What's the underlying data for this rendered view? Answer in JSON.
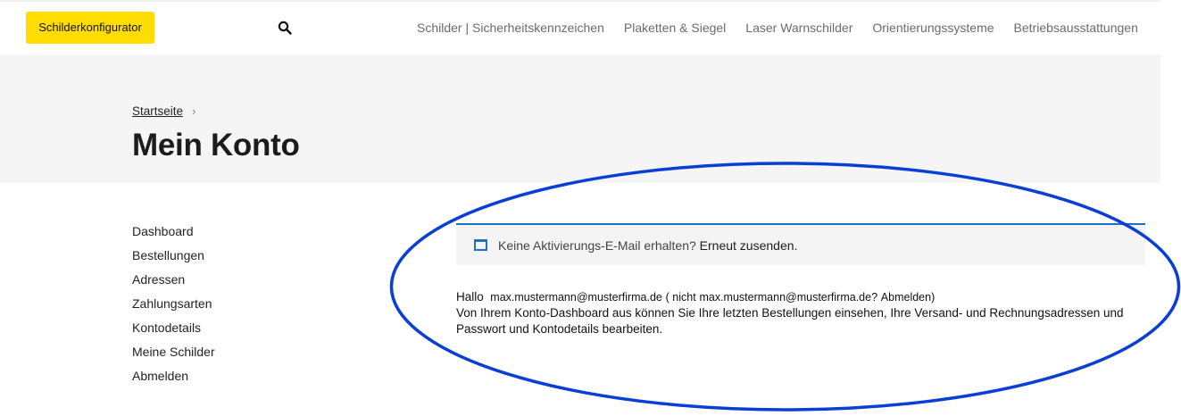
{
  "header": {
    "configurator_label": "Schilderkonfigurator",
    "search_icon": "search-icon",
    "nav": [
      "Schilder | Sicherheitskennzeichen",
      "Plaketten & Siegel",
      "Laser Warnschilder",
      "Orientierungssysteme",
      "Betriebsausstattungen"
    ]
  },
  "hero": {
    "breadcrumb_home": "Startseite",
    "breadcrumb_sep": "›",
    "title": "Mein Konto"
  },
  "sidebar": {
    "items": [
      "Dashboard",
      "Bestellungen",
      "Adressen",
      "Zahlungsarten",
      "Kontodetails",
      "Meine Schilder",
      "Abmelden"
    ]
  },
  "notice": {
    "icon": "window-icon",
    "text": "Keine Aktivierungs-E-Mail erhalten?",
    "link": "Erneut zusenden."
  },
  "greeting": {
    "hello": "Hallo",
    "email": "max.mustermann@musterfirma.de",
    "not_prefix": "( nicht",
    "not_email": "max.mustermann@musterfirma.de?",
    "logout": "Abmelden)",
    "description": "Von Ihrem Konto-Dashboard aus können Sie Ihre letzten Bestellungen einsehen, Ihre Versand- und Rechnungsadressen und Passwort und Kontodetails bearbeiten."
  },
  "colors": {
    "accent_yellow": "#ffdd00",
    "notice_blue": "#1e72bd",
    "annotation_oval": "#0a3fd6"
  }
}
